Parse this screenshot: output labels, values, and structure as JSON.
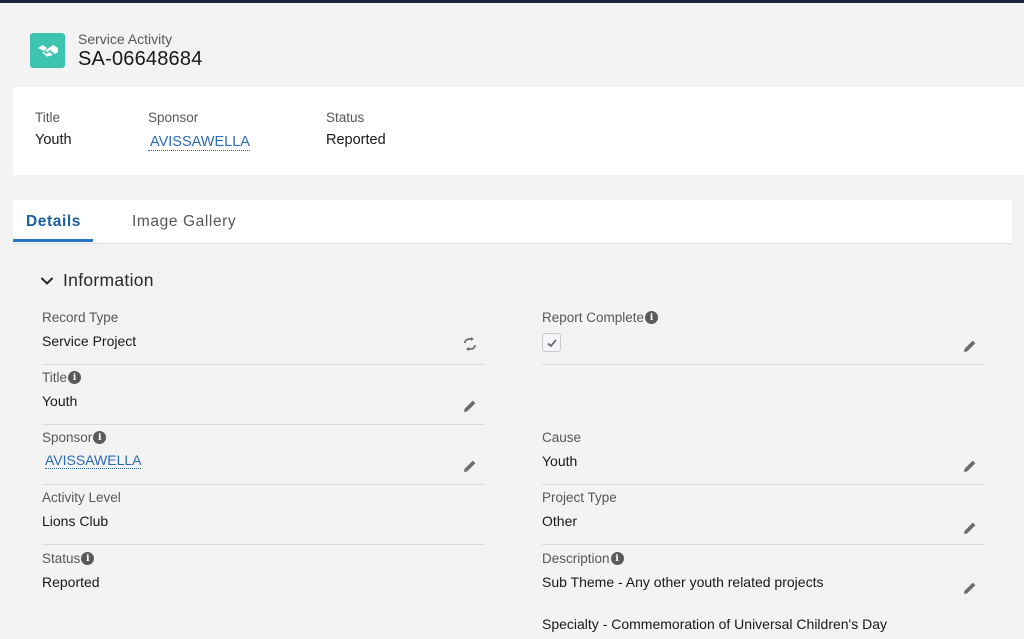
{
  "header": {
    "object_label": "Service Activity",
    "record_name": "SA-06648684",
    "icon": "handshake-icon"
  },
  "highlights": [
    {
      "label": "Title",
      "value": "Youth"
    },
    {
      "label": "Sponsor",
      "value": "AVISSAWELLA"
    },
    {
      "label": "Status",
      "value": "Reported"
    }
  ],
  "tabs": [
    {
      "label": "Details",
      "active": true
    },
    {
      "label": "Image Gallery",
      "active": false
    }
  ],
  "section": {
    "title": "Information",
    "expanded": true
  },
  "fields": {
    "record_type": {
      "label": "Record Type",
      "value": "Service Project"
    },
    "title": {
      "label": "Title",
      "value": "Youth"
    },
    "sponsor": {
      "label": "Sponsor",
      "value": "AVISSAWELLA"
    },
    "activity_level": {
      "label": "Activity Level",
      "value": "Lions Club"
    },
    "status": {
      "label": "Status",
      "value": "Reported"
    },
    "report_complete": {
      "label": "Report Complete",
      "checked": true
    },
    "cause": {
      "label": "Cause",
      "value": "Youth"
    },
    "project_type": {
      "label": "Project Type",
      "value": "Other"
    },
    "description": {
      "label": "Description",
      "line1": "Sub Theme - Any other youth related projects",
      "line2": "Specialty - Commemoration of Universal Children's Day"
    }
  },
  "colors": {
    "brand_icon": "#3cc4b0",
    "link": "#2a6bb8",
    "active_tab": "#1b5fa5"
  }
}
